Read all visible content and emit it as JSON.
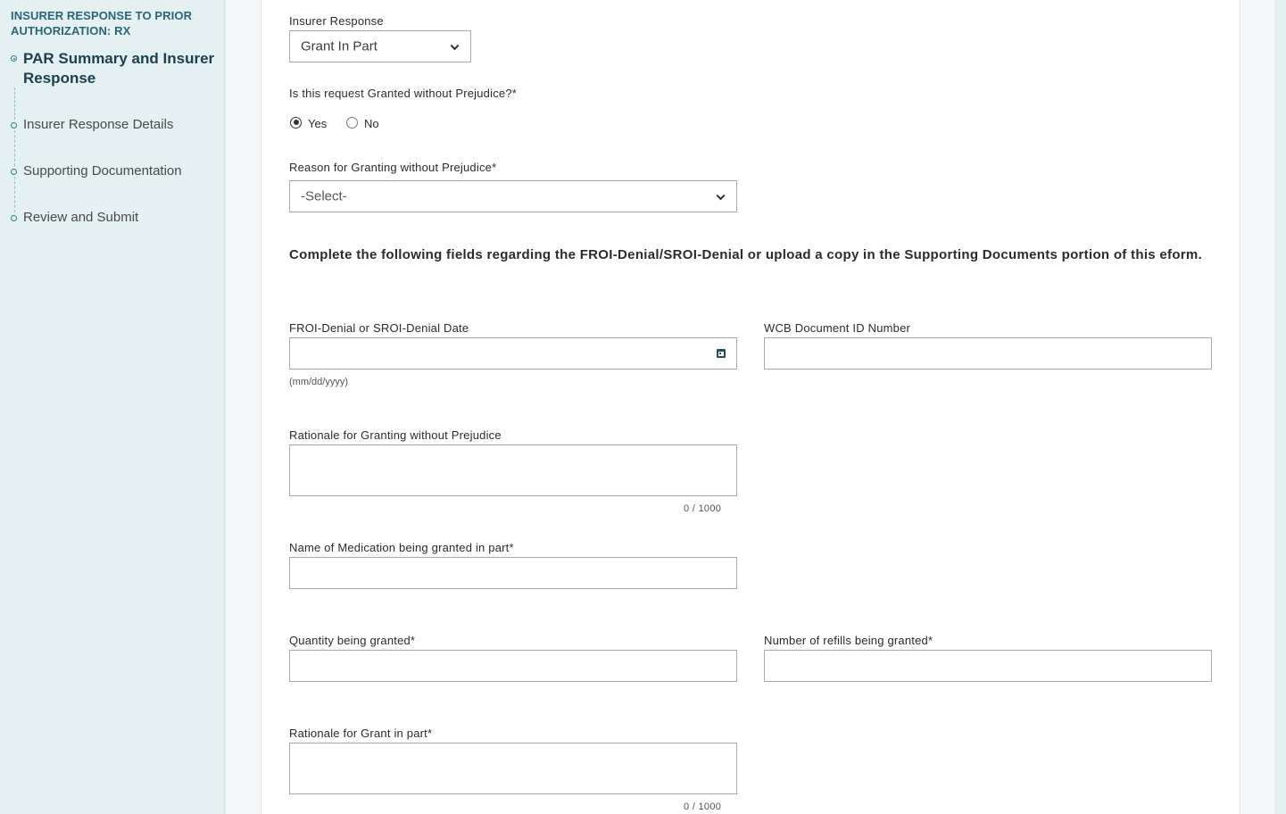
{
  "sidebar": {
    "title": "INSURER RESPONSE TO PRIOR AUTHORIZATION: RX",
    "steps": [
      {
        "label": "PAR Summary and Insurer Response",
        "active": true
      },
      {
        "label": "Insurer Response Details",
        "active": false
      },
      {
        "label": "Supporting Documentation",
        "active": false
      },
      {
        "label": "Review and Submit",
        "active": false
      }
    ]
  },
  "form": {
    "insurer_response": {
      "label": "Insurer Response",
      "value": "Grant In Part"
    },
    "granted_without_prejudice": {
      "label": "Is this request Granted without Prejudice?*",
      "options": [
        "Yes",
        "No"
      ],
      "selected": "Yes"
    },
    "reason_granting": {
      "label": "Reason for Granting without Prejudice*",
      "placeholder": "-Select-"
    },
    "instruction": "Complete the following fields regarding the FROI-Denial/SROI-Denial or upload a copy in the Supporting Documents portion of this eform.",
    "denial_date": {
      "label": "FROI-Denial or SROI-Denial Date",
      "value": "",
      "hint": "(mm/dd/yyyy)"
    },
    "wcb_doc_id": {
      "label": "WCB Document ID Number",
      "value": ""
    },
    "rationale_without_prejudice": {
      "label": "Rationale for Granting without Prejudice",
      "value": "",
      "counter": "0 / 1000"
    },
    "medication_name": {
      "label": "Name of Medication being granted in part*",
      "value": ""
    },
    "quantity": {
      "label": "Quantity being granted*",
      "value": ""
    },
    "refills": {
      "label": "Number of refills being granted*",
      "value": ""
    },
    "rationale_grant_in_part": {
      "label": "Rationale for Grant in part*",
      "value": "",
      "counter": "0 / 1000"
    }
  },
  "icons": {
    "dropdown": "chevron-down-icon",
    "calendar": "calendar-icon",
    "step": "step-circle-icon"
  },
  "colors": {
    "sidebar_bg": "#e4f0f2",
    "sidebar_title": "#2a6577",
    "active_step": "#1b4150",
    "accent": "#2d7f86"
  }
}
